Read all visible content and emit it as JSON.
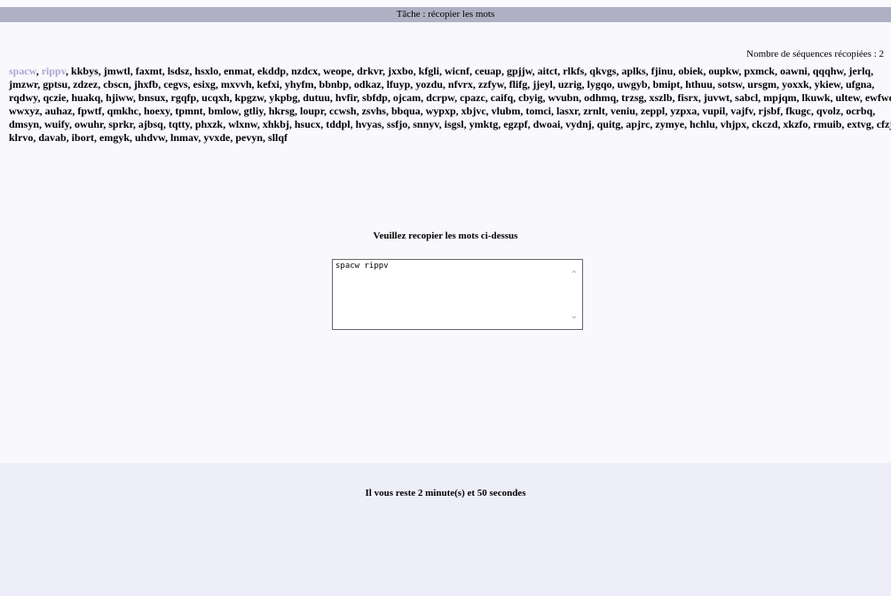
{
  "header": {
    "title": "Tâche : récopier les mots"
  },
  "counter": {
    "label": "Nombre de séquences récopiées : 2"
  },
  "words": {
    "done": [
      "spacw",
      "rippv"
    ],
    "remaining": "kkbys, jmwtl, faxmt, lsdsz, hsxlo, enmat, ekddp, nzdcx, weope, drkvr, jxxbo, kfgli, wicnf, ceuap, gpjjw, aitct, rlkfs, qkvgs, aplks, fjinu, obiek, oupkw, pxmck, oawni, qqqhw, jerlq, jmzwr, gptsu, zdzez, cbscn, jhxfb, cegvs, esixg, mxvvh, kefxi, yhyfm, bbnbp, odkaz, lfuyp, yozdu, nfvrx, zzfyw, flifg, jjeyl, uzrig, lygqo, uwgyb, bmipt, hthuu, sotsw, ursgm, yoxxk, ykiew, ufgna, rqdwy, qczie, huakq, hjiww, bnsux, rgqfp, ucqxh, kpgzw, ykpbg, dutuu, hvfir, sbfdp, ojcam, dcrpw, cpazc, caifq, cbyig, wvubn, odhmq, trzsg, xszlb, fisrx, juvwt, sabcl, mpjqm, lkuwk, ultew, ewfwd, wwxyz, auhaz, fpwtf, qmkhc, hoexy, tpmnt, bmlow, gtliy, hkrsg, loupr, ccwsh, zsvhs, bbqua, wypxp, xbjvc, vlubm, tomci, lasxr, zrnlt, veniu, zeppl, yzpxa, vupil, vajfv, rjsbf, fkugc, qvolz, ocrbq, dmsyn, wuify, owuhr, sprkr, ajbsq, tqtty, phxzk, wlxnw, xhkbj, hsucx, tddpl, hvyas, ssfjo, snnyv, isgsl, ymktg, egzpf, dwoai, vydnj, quitg, apjrc, zymye, hchlu, vhjpx, ckczd, xkzfo, rmuib, extvg, cfzjy, klrvo, davab, ibort, emgyk, uhdvw, lnmav, yvxde, pevyn, sllqf"
  },
  "instruction": "Veuillez recopier les mots ci-dessus",
  "answer": {
    "value": "spacw rippv"
  },
  "timer": {
    "text": "Il vous reste 2 minute(s) et 50 secondes"
  },
  "icons": {
    "scroll_up": "chevron-up-icon",
    "scroll_down": "chevron-down-icon"
  },
  "colors": {
    "titlebar": "#b0b0c4",
    "done_word": "#a8a8d2",
    "footer": "#eeeefb",
    "page": "#f8f8fd"
  }
}
